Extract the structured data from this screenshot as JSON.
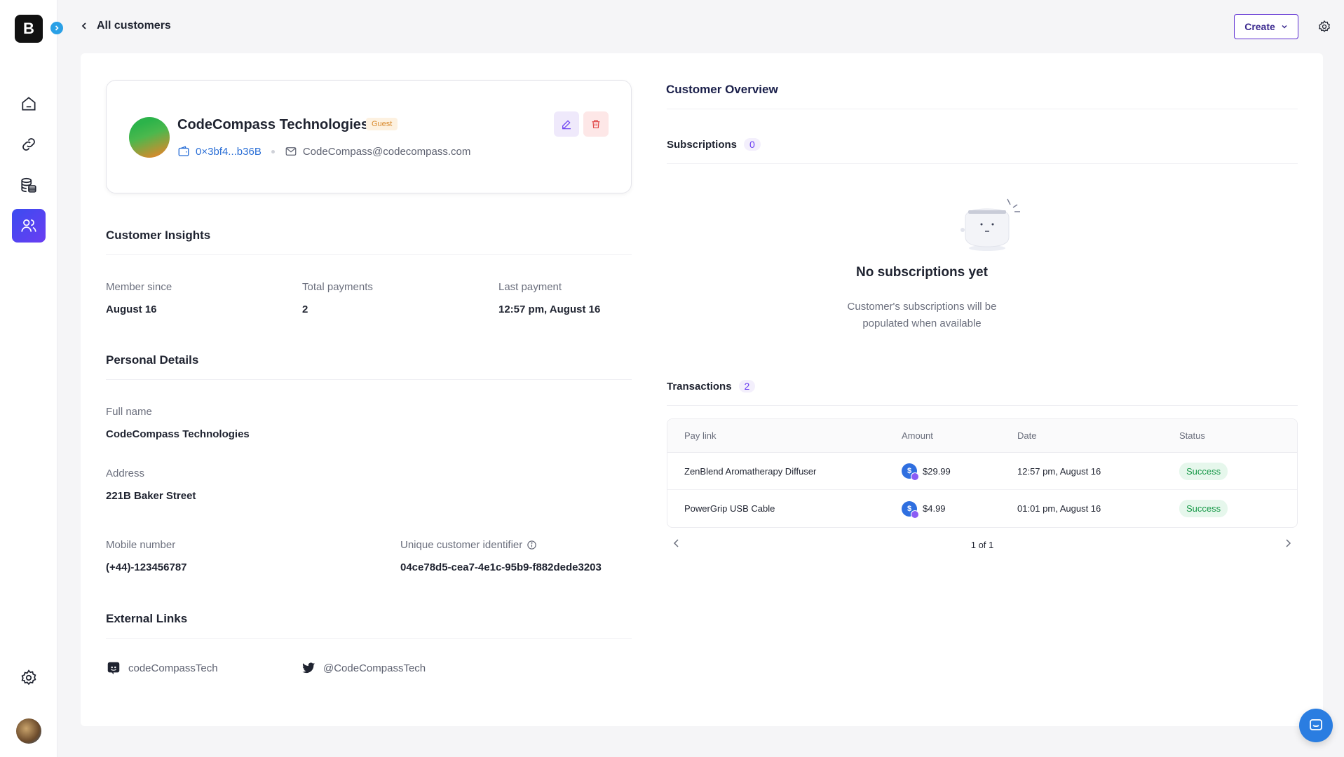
{
  "app": {
    "logo_letter": "B",
    "brand_color": "#111111",
    "accent_color": "#6a3df2"
  },
  "sidebar": {
    "items": [
      {
        "name": "home",
        "icon": "home-icon",
        "active": false
      },
      {
        "name": "links",
        "icon": "link-icon",
        "active": false
      },
      {
        "name": "payments",
        "icon": "database-coins-icon",
        "active": false
      },
      {
        "name": "customers",
        "icon": "users-icon",
        "active": true
      }
    ],
    "settings_icon": "gear-icon",
    "avatar": "user-avatar"
  },
  "header": {
    "back_label": "All customers",
    "create_label": "Create"
  },
  "profile": {
    "name": "CodeCompass Technologies",
    "badge": "Guest",
    "wallet": "0×3bf4...b36B",
    "email": "CodeCompass@codecompass.com"
  },
  "insights": {
    "title": "Customer Insights",
    "member_since_label": "Member since",
    "member_since_value": "August 16",
    "total_payments_label": "Total payments",
    "total_payments_value": "2",
    "last_payment_label": "Last payment",
    "last_payment_value": "12:57 pm, August 16"
  },
  "personal": {
    "title": "Personal Details",
    "full_name_label": "Full name",
    "full_name_value": "CodeCompass Technologies",
    "address_label": "Address",
    "address_value": "221B Baker Street",
    "mobile_label": "Mobile number",
    "mobile_value": "(+44)-123456787",
    "uid_label": "Unique customer identifier",
    "uid_value": "04ce78d5-cea7-4e1c-95b9-f882dede3203"
  },
  "external": {
    "title": "External Links",
    "discord": "codeCompassTech",
    "twitter": "@CodeCompassTech"
  },
  "overview": {
    "title": "Customer Overview",
    "subscriptions_label": "Subscriptions",
    "subscriptions_count": "0",
    "empty_title": "No subscriptions yet",
    "empty_desc": "Customer's subscriptions will be populated when available",
    "transactions_label": "Transactions",
    "transactions_count": "2"
  },
  "transactions": {
    "columns": [
      "Pay link",
      "Amount",
      "Date",
      "Status"
    ],
    "rows": [
      {
        "pay_link": "ZenBlend Aromatherapy Diffuser",
        "amount": "$29.99",
        "date": "12:57 pm, August 16",
        "status": "Success"
      },
      {
        "pay_link": "PowerGrip USB Cable",
        "amount": "$4.99",
        "date": "01:01 pm, August 16",
        "status": "Success"
      }
    ],
    "pager": "1 of 1"
  }
}
